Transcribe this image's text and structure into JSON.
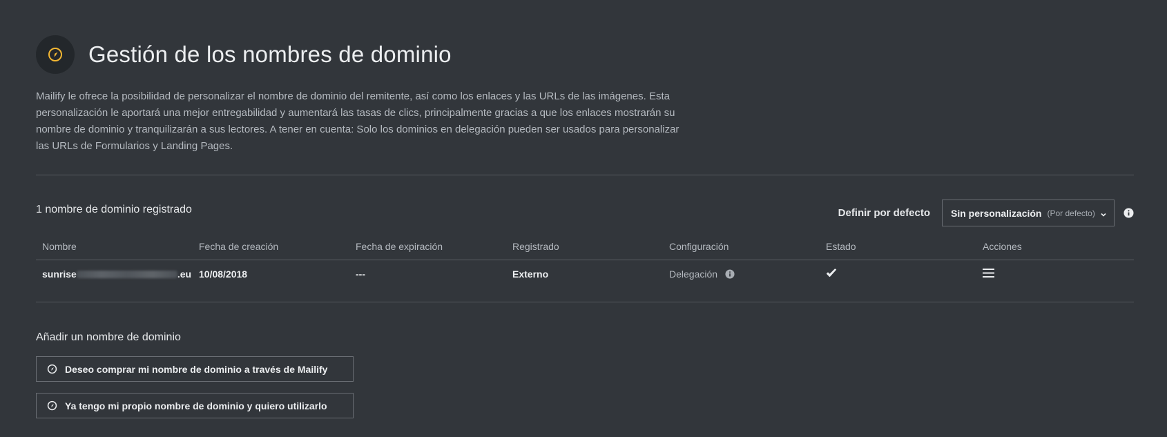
{
  "header": {
    "title": "Gestión de los nombres de dominio",
    "icon": "compass-icon",
    "icon_color": "#f2b632"
  },
  "intro": "Mailify le ofrece la posibilidad de personalizar el nombre de dominio del remitente, así como los enlaces y las URLs de las imágenes. Esta personalización le aportará una mejor entregabilidad y aumentará las tasas de clics, principalmente gracias a que los enlaces mostrarán su nombre de dominio y tranquilizarán a sus lectores. A tener en cuenta: Solo los dominios en delegación pueden ser usados para personalizar las URLs de Formularios y Landing Pages.",
  "domains": {
    "count_label": "1 nombre de dominio registrado",
    "default_label": "Definir por defecto",
    "default_select": {
      "value": "Sin personalización",
      "sub": "(Por defecto)"
    },
    "columns": [
      "Nombre",
      "Fecha de creación",
      "Fecha de expiración",
      "Registrado",
      "Configuración",
      "Estado",
      "Acciones"
    ],
    "rows": [
      {
        "name_prefix": "sunrise",
        "name_suffix": ".eu",
        "created": "10/08/2018",
        "expires": "---",
        "registered": "Externo",
        "configuration": "Delegación",
        "status_icon": "check-icon",
        "actions_icon": "menu-icon"
      }
    ]
  },
  "add": {
    "title": "Añadir un nombre de dominio",
    "buy_label": "Deseo comprar mi nombre de dominio a través de Mailify",
    "own_label": "Ya tengo mi propio nombre de dominio y quiero utilizarlo"
  }
}
